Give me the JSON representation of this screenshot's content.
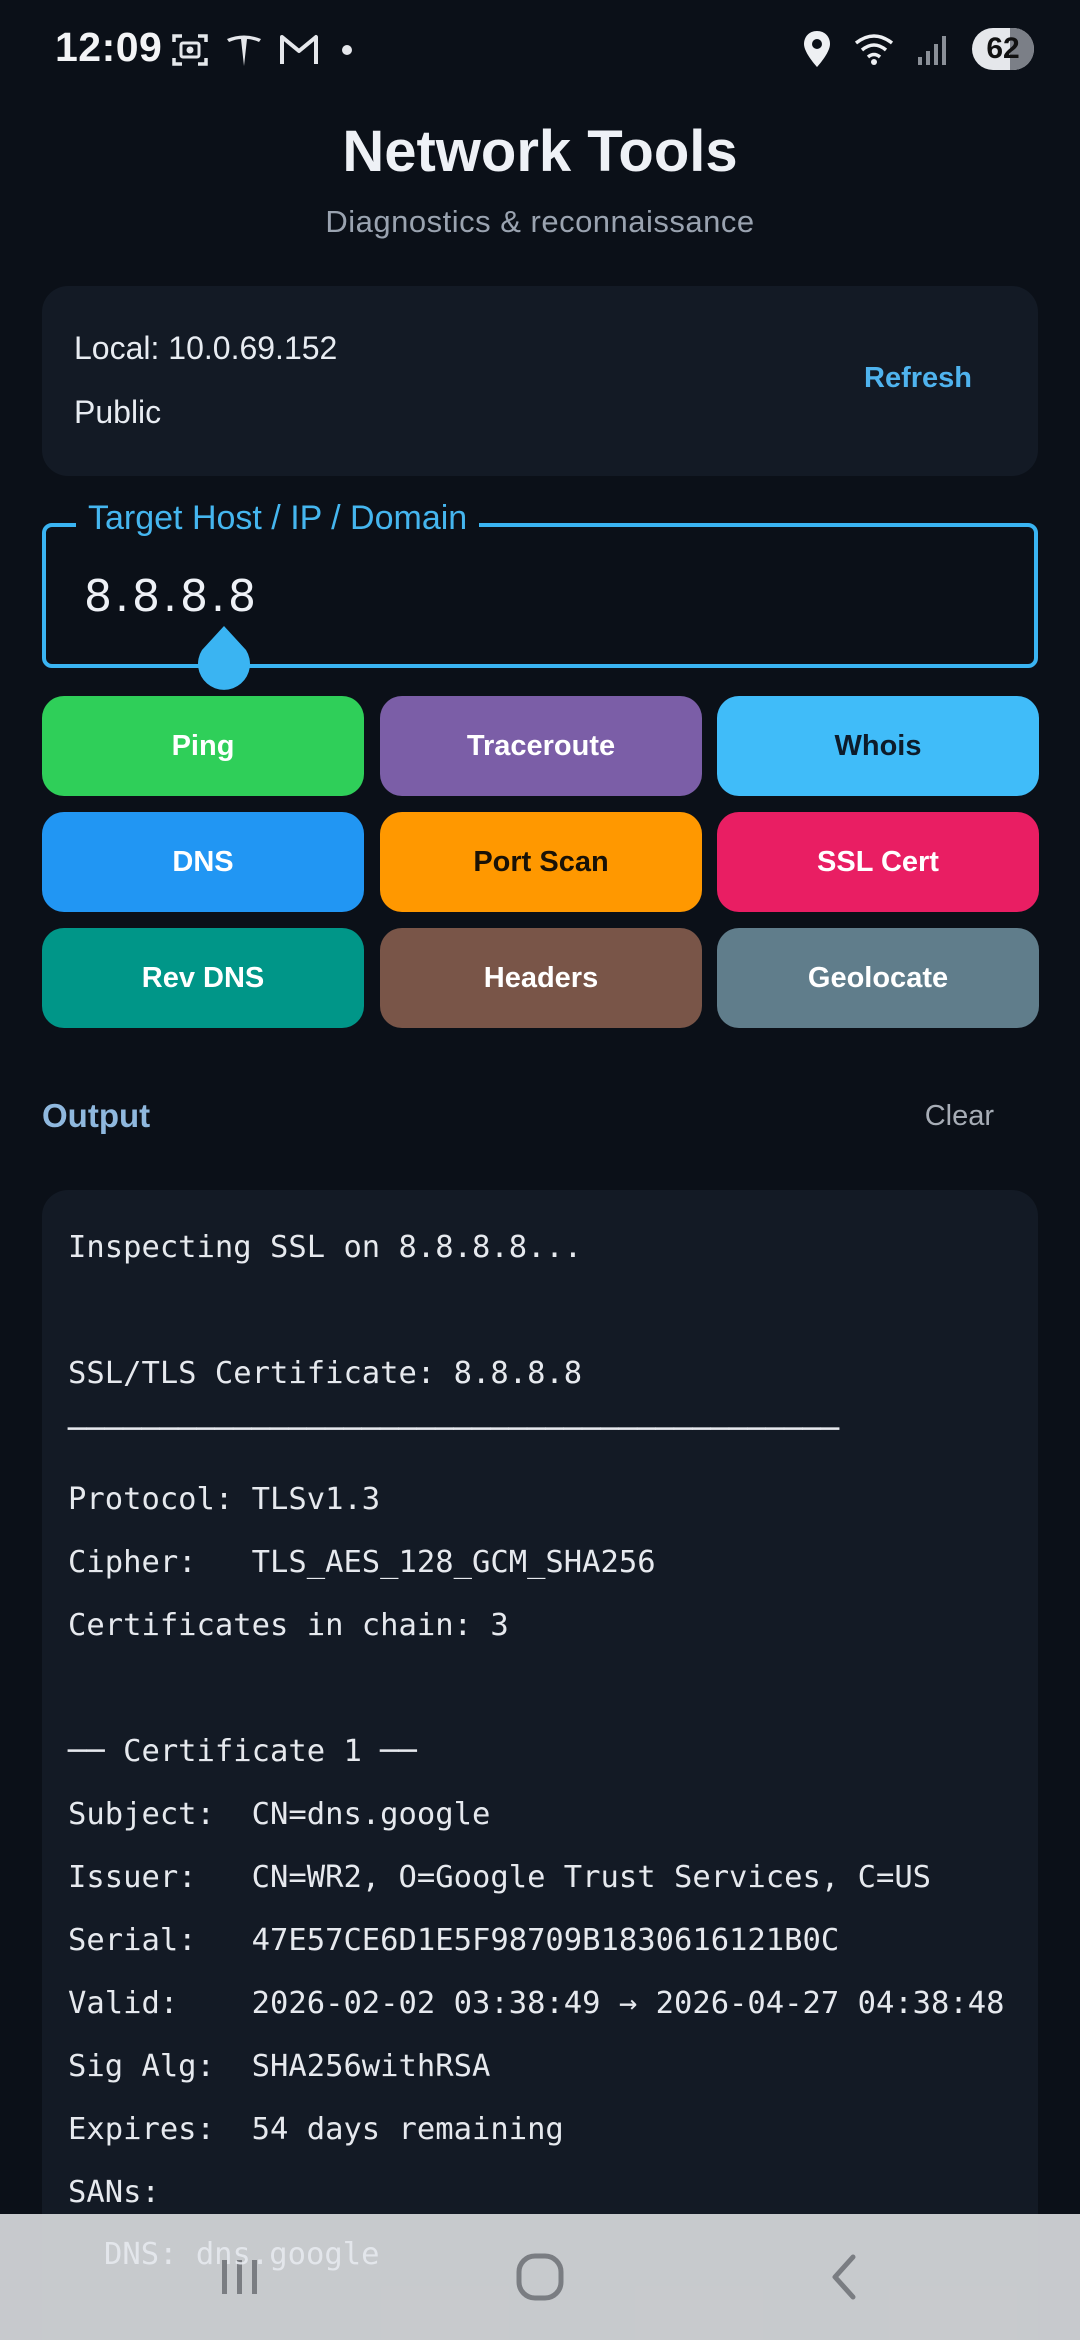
{
  "status_bar": {
    "time": "12:09",
    "battery": "62",
    "left_icons": [
      "screenshot-icon",
      "tesla-icon",
      "gmail-icon",
      "notification-dot"
    ],
    "right_icons": [
      "location-icon",
      "wifi-icon",
      "signal-icon",
      "battery-icon"
    ]
  },
  "header": {
    "title": "Network Tools",
    "subtitle": "Diagnostics & reconnaissance"
  },
  "ip_card": {
    "local": "Local: 10.0.69.152",
    "public": "Public",
    "refresh_label": "Refresh"
  },
  "target": {
    "label": "Target Host / IP / Domain",
    "value": "8.8.8.8"
  },
  "tools": [
    {
      "label": "Ping",
      "bg": "#2fcf59",
      "fg": "#ffffff"
    },
    {
      "label": "Traceroute",
      "bg": "#7b5ea7",
      "fg": "#ffffff"
    },
    {
      "label": "Whois",
      "bg": "#40bcf9",
      "fg": "#0d1b2a"
    },
    {
      "label": "DNS",
      "bg": "#2196f3",
      "fg": "#ffffff"
    },
    {
      "label": "Port Scan",
      "bg": "#ff9800",
      "fg": "#1a1206"
    },
    {
      "label": "SSL Cert",
      "bg": "#e91e63",
      "fg": "#ffffff"
    },
    {
      "label": "Rev DNS",
      "bg": "#009688",
      "fg": "#ffffff"
    },
    {
      "label": "Headers",
      "bg": "#795548",
      "fg": "#ffffff"
    },
    {
      "label": "Geolocate",
      "bg": "#607d8b",
      "fg": "#ffffff"
    }
  ],
  "output": {
    "label": "Output",
    "clear_label": "Clear",
    "lines": [
      "Inspecting SSL on 8.8.8.8...",
      "",
      "SSL/TLS Certificate: 8.8.8.8",
      "──────────────────────────────────────────",
      "Protocol: TLSv1.3",
      "Cipher:   TLS_AES_128_GCM_SHA256",
      "Certificates in chain: 3",
      "",
      "── Certificate 1 ──",
      "Subject:  CN=dns.google",
      "Issuer:   CN=WR2, O=Google Trust Services, C=US",
      "Serial:   47E57CE6D1E5F98709B1830616121B0C",
      "Valid:    2026-02-02 03:38:49 → 2026-04-27 04:38:48",
      "Sig Alg:  SHA256withRSA",
      "Expires:  54 days remaining",
      "SANs:"
    ],
    "overlap_line": "DNS: dns.google"
  },
  "nav": {
    "icons": [
      "recents-icon",
      "home-icon",
      "back-icon"
    ]
  }
}
